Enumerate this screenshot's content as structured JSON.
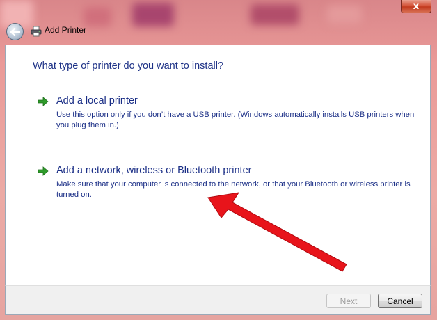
{
  "window": {
    "title": "Add Printer",
    "close_glyph": "x"
  },
  "main": {
    "heading": "What type of printer do you want to install?",
    "options": [
      {
        "title": "Add a local printer",
        "description": "Use this option only if you don’t have a USB printer. (Windows automatically installs USB printers when you plug them in.)",
        "icon": "green-arrow-icon"
      },
      {
        "title": "Add a network, wireless or Bluetooth printer",
        "description": "Make sure that your computer is connected to the network, or that your Bluetooth or wireless printer is turned on.",
        "icon": "green-arrow-icon"
      }
    ]
  },
  "footer": {
    "next_label": "Next",
    "cancel_label": "Cancel"
  },
  "colors": {
    "link_blue": "#1a2e86",
    "arrow_green": "#2e9b2a",
    "annotation_red": "#e8141b"
  }
}
